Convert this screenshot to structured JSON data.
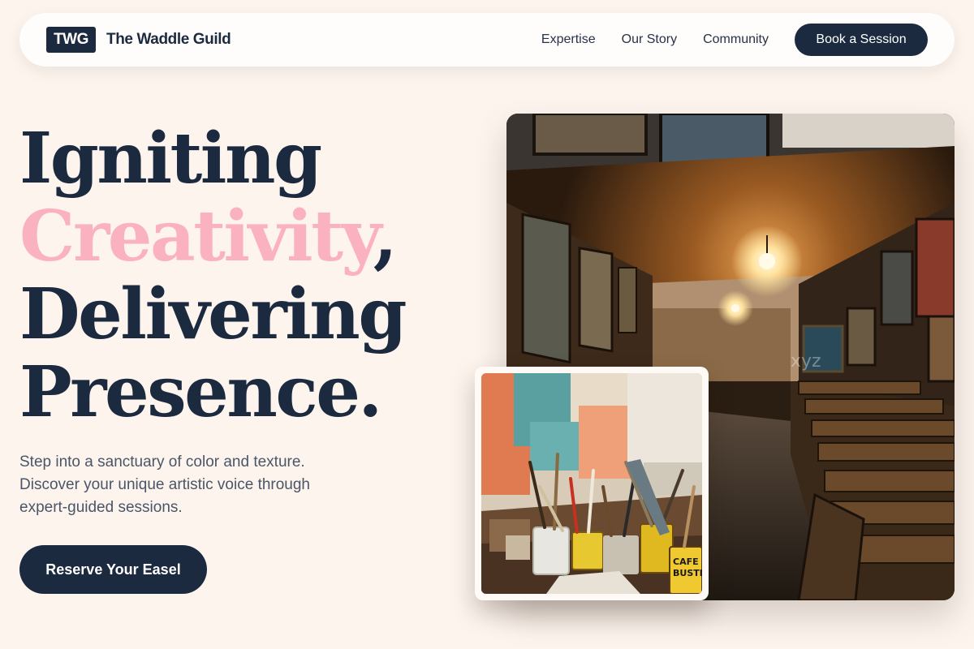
{
  "nav": {
    "logo_abbr": "TWG",
    "brand_name": "The Waddle Guild",
    "links": [
      "Expertise",
      "Our Story",
      "Community"
    ],
    "cta_label": "Book a Session"
  },
  "hero": {
    "title_line1": "Igniting",
    "title_accent": "Creativity",
    "title_comma": ",",
    "title_line3": "Delivering",
    "title_line4": "Presence.",
    "subtitle_lines": [
      "Step into a sanctuary of color and texture.",
      "Discover your unique artistic voice through",
      "expert-guided sessions."
    ],
    "cta_label": "Reserve Your Easel"
  },
  "images": {
    "main_watermark": "xyz"
  },
  "colors": {
    "background": "#fdf4ee",
    "primary": "#1c2a40",
    "accent_pink": "#fbb2c0",
    "body_text": "#4a5668"
  }
}
